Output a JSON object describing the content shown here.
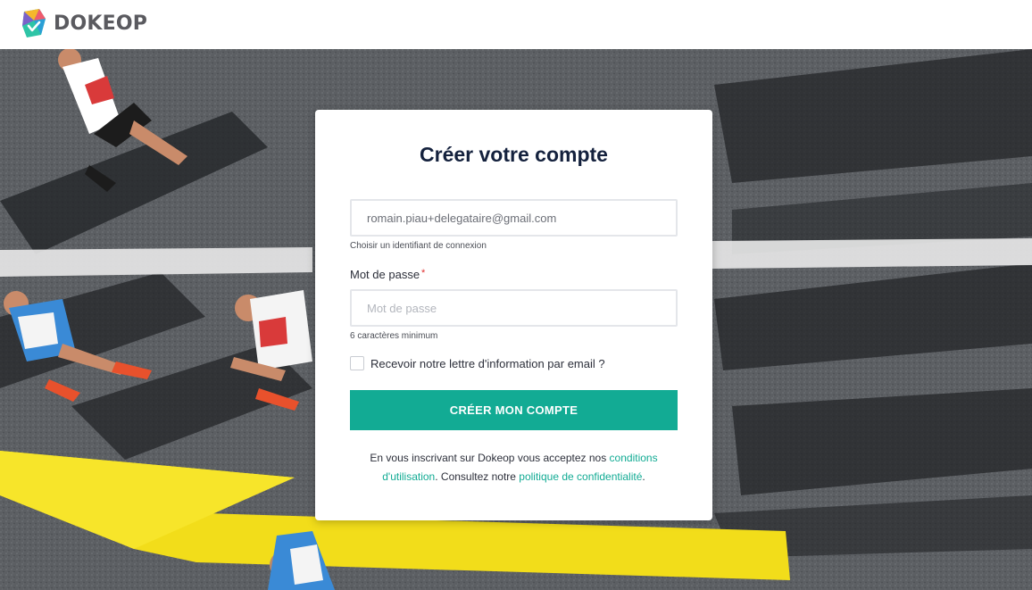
{
  "app": {
    "brand_name": "DOKEOP",
    "logo_icon": "dokeop-logo-icon",
    "colors": {
      "accent": "#12ab94",
      "title": "#14213d",
      "required": "#e02f2f"
    }
  },
  "form": {
    "title": "Créer votre compte",
    "email": {
      "value": "romain.piau+delegataire@gmail.com",
      "hint": "Choisir un identifiant de connexion"
    },
    "password": {
      "label": "Mot de passe",
      "required_mark": "*",
      "placeholder": "Mot de passe",
      "hint": "6 caractères minimum"
    },
    "newsletter": {
      "label": "Recevoir notre lettre d'information par email ?",
      "checked": false
    },
    "submit_label": "CRÉER MON COMPTE",
    "legal": {
      "text_1": "En vous inscrivant sur Dokeop vous acceptez nos ",
      "terms_link": "conditions d'utilisation",
      "text_2": ". Consultez notre ",
      "privacy_link": "politique de confidentialité",
      "text_3": "."
    }
  }
}
